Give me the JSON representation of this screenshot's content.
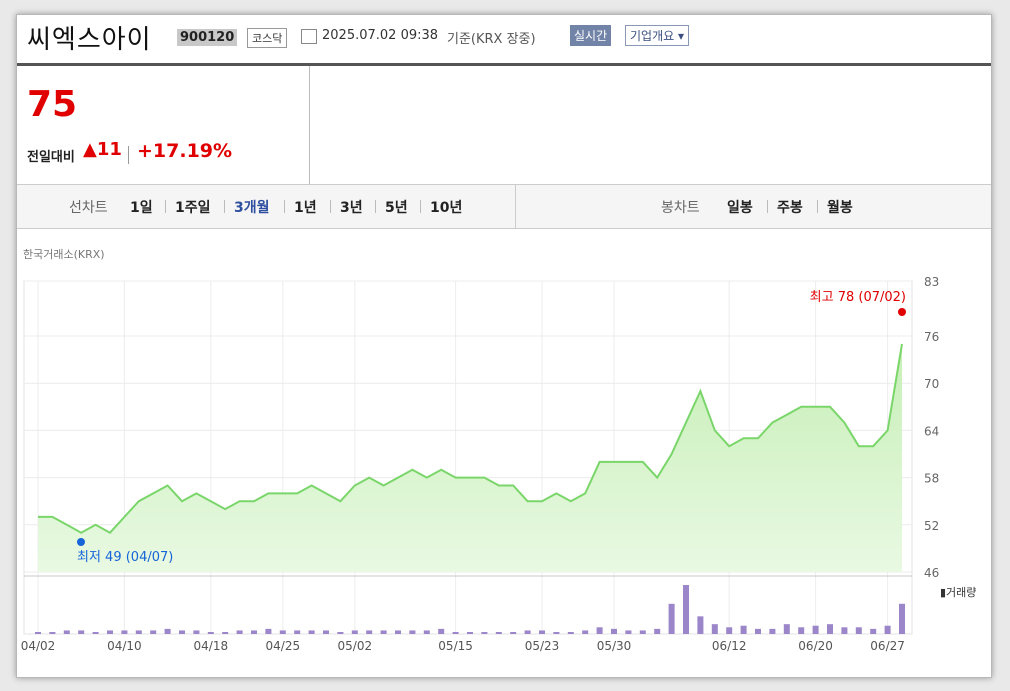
{
  "header": {
    "name": "씨엑스아이",
    "code": "900120",
    "market": "코스닥",
    "datetime": "2025.07.02 09:38",
    "basis": "기준(KRX 장중)",
    "realtime_label": "실시간",
    "company_label": "기업개요 ▾"
  },
  "price": {
    "current": "75",
    "change_label": "전일대비",
    "change": "▲11",
    "percent": "+17.19%"
  },
  "tabs": {
    "line_label": "선차트",
    "periods": [
      "1일",
      "1주일",
      "3개월",
      "1년",
      "3년",
      "5년",
      "10년"
    ],
    "selected": "3개월",
    "candle_label": "봉차트",
    "candles": [
      "일봉",
      "주봉",
      "월봉"
    ]
  },
  "exchange": "한국거래소(KRX)",
  "colors": {
    "up": "#e00000",
    "line": "#7ad66a",
    "area": "#e9f9e3",
    "volume": "#9b86c9",
    "low_point": "#1565d8",
    "high_point": "#e00000"
  },
  "chart_data": {
    "type": "area",
    "ylim": [
      46,
      83
    ],
    "yticks": [
      46,
      52,
      58,
      64,
      70,
      76,
      83
    ],
    "xticks": [
      "04/02",
      "04/10",
      "04/18",
      "04/25",
      "05/02",
      "05/15",
      "05/23",
      "05/30",
      "06/12",
      "06/20",
      "06/27"
    ],
    "price": [
      53,
      53,
      52,
      51,
      52,
      51,
      53,
      55,
      56,
      57,
      55,
      56,
      55,
      54,
      55,
      55,
      56,
      56,
      56,
      57,
      56,
      55,
      57,
      58,
      57,
      58,
      59,
      58,
      59,
      58,
      58,
      58,
      57,
      57,
      55,
      55,
      56,
      55,
      56,
      60,
      60,
      60,
      60,
      58,
      61,
      65,
      69,
      64,
      62,
      63,
      63,
      65,
      66,
      67,
      67,
      67,
      65,
      62,
      62,
      64,
      75
    ],
    "volume": [
      0,
      0,
      1,
      1,
      0,
      1,
      1,
      1,
      1,
      2,
      1,
      1,
      0,
      0,
      1,
      1,
      2,
      1,
      1,
      1,
      1,
      0,
      1,
      1,
      1,
      1,
      1,
      1,
      2,
      0,
      0,
      0,
      0,
      0,
      1,
      1,
      0,
      0,
      1,
      3,
      2,
      1,
      1,
      2,
      18,
      30,
      10,
      5,
      3,
      4,
      2,
      2,
      5,
      3,
      4,
      5,
      3,
      3,
      2,
      4,
      18
    ],
    "volume_label": "거래량",
    "high_label": "최고 78 (07/02)",
    "low_label": "최저 49 (04/07)"
  }
}
